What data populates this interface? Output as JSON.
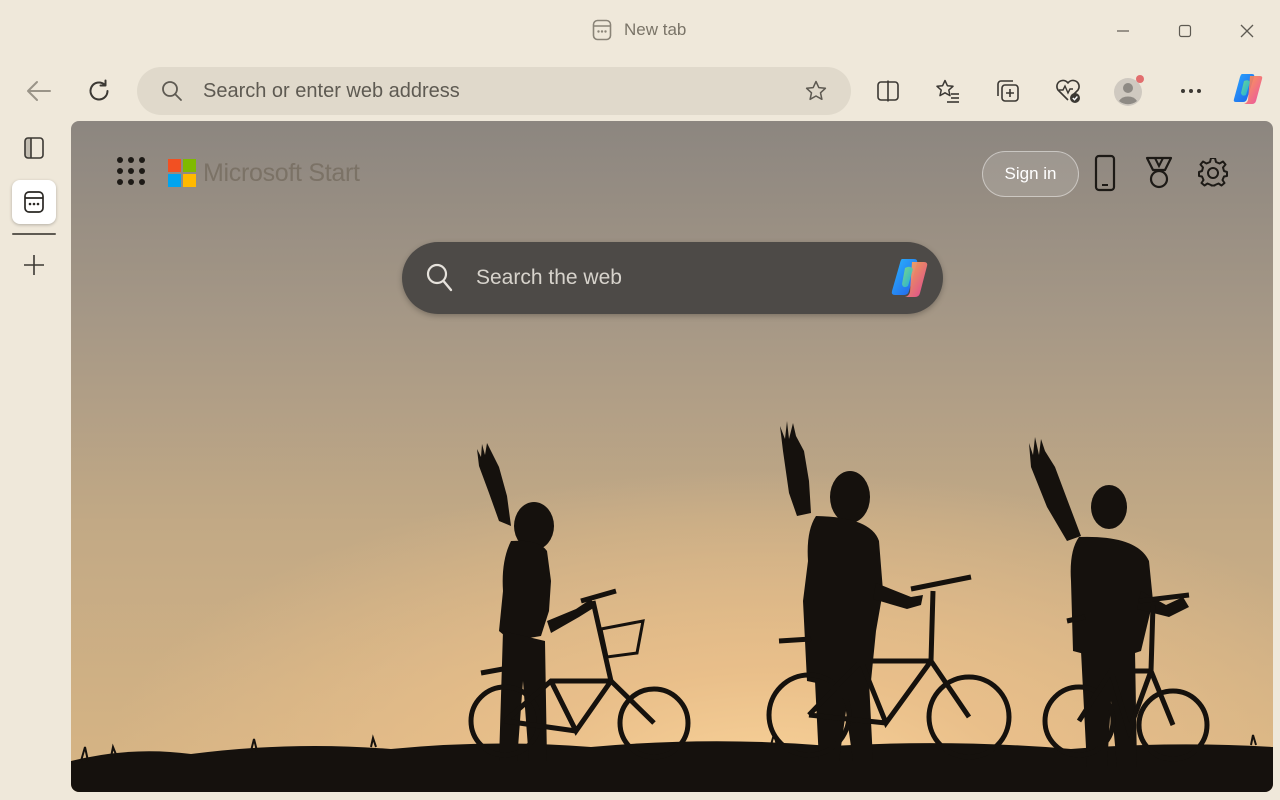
{
  "window": {
    "tab_title": "New tab"
  },
  "toolbar": {
    "address_placeholder": "Search or enter web address",
    "icons": [
      "back-icon",
      "refresh-icon",
      "search-icon",
      "favorite-star-icon",
      "split-screen-icon",
      "favorites-icon",
      "collections-icon",
      "browser-essentials-icon",
      "profile-icon",
      "more-icon",
      "copilot-icon"
    ]
  },
  "sidebar": {
    "items": [
      "tab-actions-icon",
      "new-tab-page-icon",
      "new-tab-plus-icon"
    ]
  },
  "page": {
    "brand": "Microsoft Start",
    "sign_in": "Sign in",
    "search_placeholder": "Search the web",
    "top_icons": [
      "phone-icon",
      "rewards-icon",
      "settings-icon"
    ]
  },
  "colors": {
    "chrome": "#efe8da",
    "address_bar": "#e0d9cb",
    "search_box": "#4d4a47",
    "profile_notification": "#e26e6e"
  }
}
